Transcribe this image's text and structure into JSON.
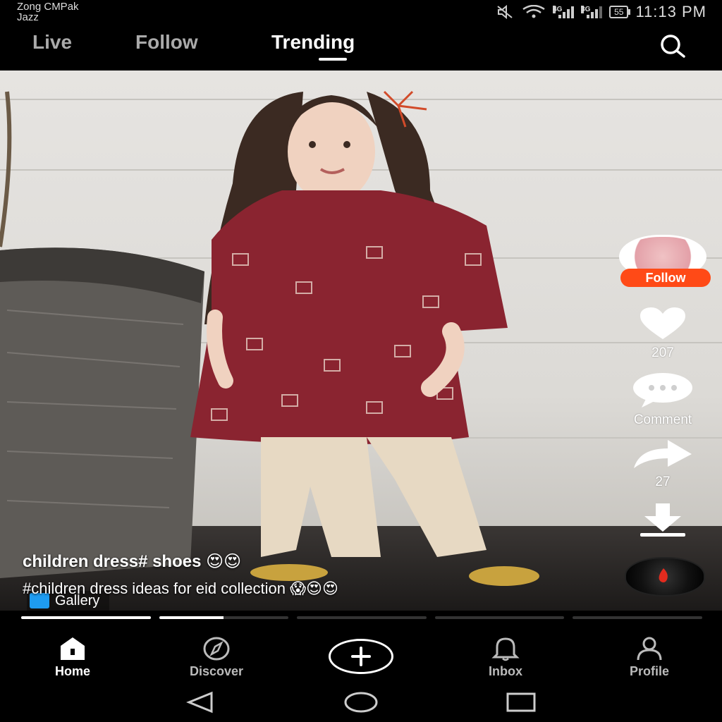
{
  "status_bar": {
    "carrier_line1": "Zong CMPak",
    "carrier_line2": "Jazz",
    "network1": "4G",
    "network2": "3G",
    "battery": "55",
    "time": "11:13 PM"
  },
  "top_nav": {
    "tabs": [
      {
        "label": "Live"
      },
      {
        "label": "Follow"
      },
      {
        "label": "Trending"
      }
    ],
    "active_tab": "Trending",
    "search_icon": "search-icon"
  },
  "video": {
    "follow_label": "Follow",
    "likes": "207",
    "comment_label": "Comment",
    "shares": "27",
    "gallery_label": "Gallery",
    "title": "children dress# shoes 😍😍",
    "description": "#children dress ideas for eid collection 😱😍😍",
    "progress_segments": [
      1.0,
      0.5,
      0,
      0,
      0
    ]
  },
  "bottom_nav": {
    "items": [
      {
        "label": "Home",
        "icon": "home-icon"
      },
      {
        "label": "Discover",
        "icon": "compass-icon"
      },
      {
        "label": "",
        "icon": "plus-icon"
      },
      {
        "label": "Inbox",
        "icon": "bell-icon"
      },
      {
        "label": "Profile",
        "icon": "person-icon"
      }
    ],
    "active": "Home"
  },
  "colors": {
    "accent": "#ff4a17",
    "background": "#000000",
    "text": "#ffffff"
  }
}
